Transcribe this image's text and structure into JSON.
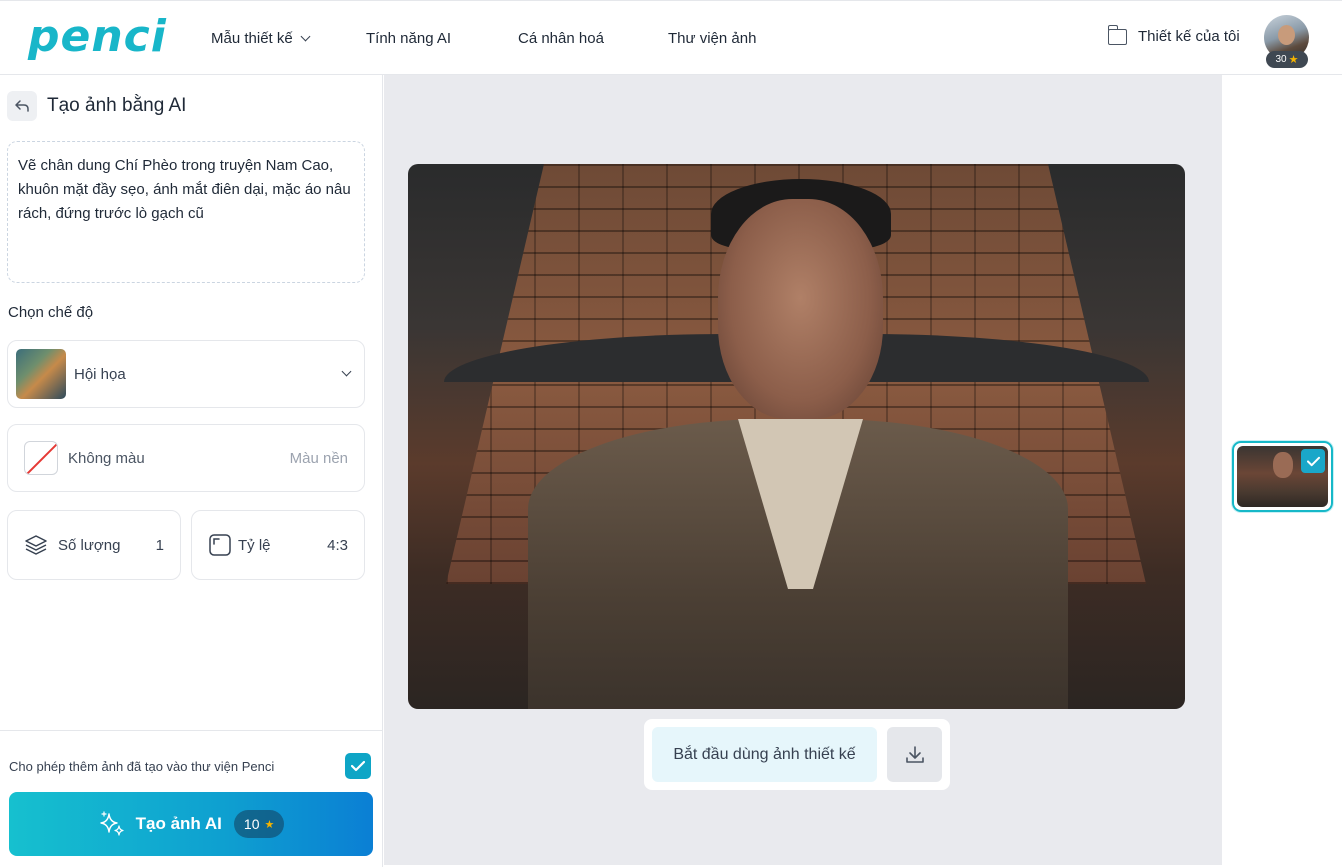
{
  "brand": {
    "logo_text": "penci",
    "accent": "#18b6c9"
  },
  "nav": {
    "items": [
      {
        "label": "Mẫu thiết kế",
        "has_dropdown": true
      },
      {
        "label": "Tính năng AI"
      },
      {
        "label": "Cá nhân hoá"
      },
      {
        "label": "Thư viện ảnh"
      }
    ],
    "my_designs": "Thiết kế của tôi",
    "credits": "30"
  },
  "panel": {
    "title": "Tạo ảnh bằng AI",
    "prompt": "Vẽ chân dung Chí Phèo trong truyện Nam Cao, khuôn mặt đầy sẹo, ánh mắt điên dại, mặc áo nâu rách, đứng trước lò gạch cũ",
    "mode_section_label": "Chọn chế độ",
    "mode_value": "Hội họa",
    "color_value": "Không màu",
    "color_hint": "Màu nền",
    "quantity_label": "Số lượng",
    "quantity_value": "1",
    "ratio_label": "Tỷ lệ",
    "ratio_value": "4:3",
    "allow_library_text": "Cho phép thêm ảnh đã tạo vào thư viện Penci",
    "allow_library_checked": true,
    "generate_label": "Tạo ảnh AI",
    "generate_cost": "10"
  },
  "canvas": {
    "use_button": "Bắt đầu dùng ảnh thiết kế",
    "download_icon": "download-icon"
  },
  "results": {
    "count": 1,
    "selected_index": 0
  }
}
